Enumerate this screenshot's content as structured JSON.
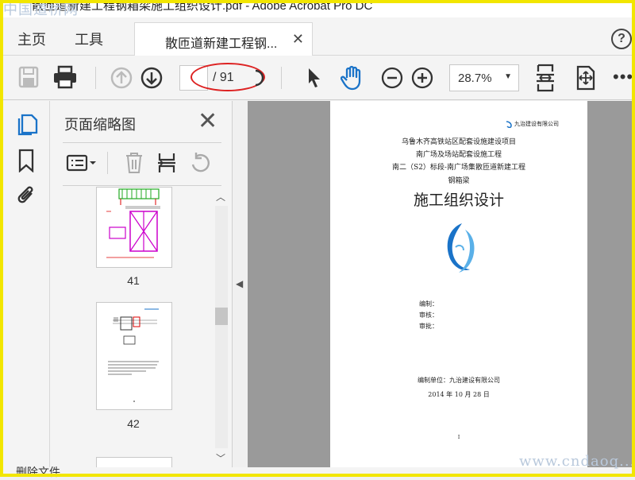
{
  "window": {
    "title": "散匝道新建工程钢箱梁施工组织设计.pdf - Adobe Acrobat Pro DC",
    "watermark_top": "中国道桥网",
    "watermark_bottom": "www.cndaoq..."
  },
  "tabs": {
    "home": "主页",
    "tools": "工具",
    "document": "散匝道新建工程钢...",
    "help": "?"
  },
  "toolbar": {
    "page_current": "",
    "page_total": "/ 91",
    "zoom": "28.7%"
  },
  "panel": {
    "title": "页面缩略图",
    "thumbnails": [
      {
        "number": "41"
      },
      {
        "number": "42"
      }
    ]
  },
  "document_page": {
    "company_logo_text": "九治建设有限公司",
    "line1": "乌鲁木齐高铁站区配套设施建设项目",
    "line2": "南广场及场站配套设施工程",
    "line3": "南二（S2）标段-南广场集散匝道新建工程",
    "line4": "钢箱梁",
    "heading": "施工组织设计",
    "prepared_by": "编制：",
    "reviewed_by": "审核：",
    "approved_by": "审批：",
    "unit": "编制单位：九治建设有限公司",
    "date": "2014 年 10 月 28 日",
    "footer_mark": "I"
  },
  "status": {
    "text": "删除文件"
  },
  "colors": {
    "accent_blue": "#1a73c8",
    "annotation_red": "#d22222",
    "frame_yellow": "#f2e600"
  }
}
